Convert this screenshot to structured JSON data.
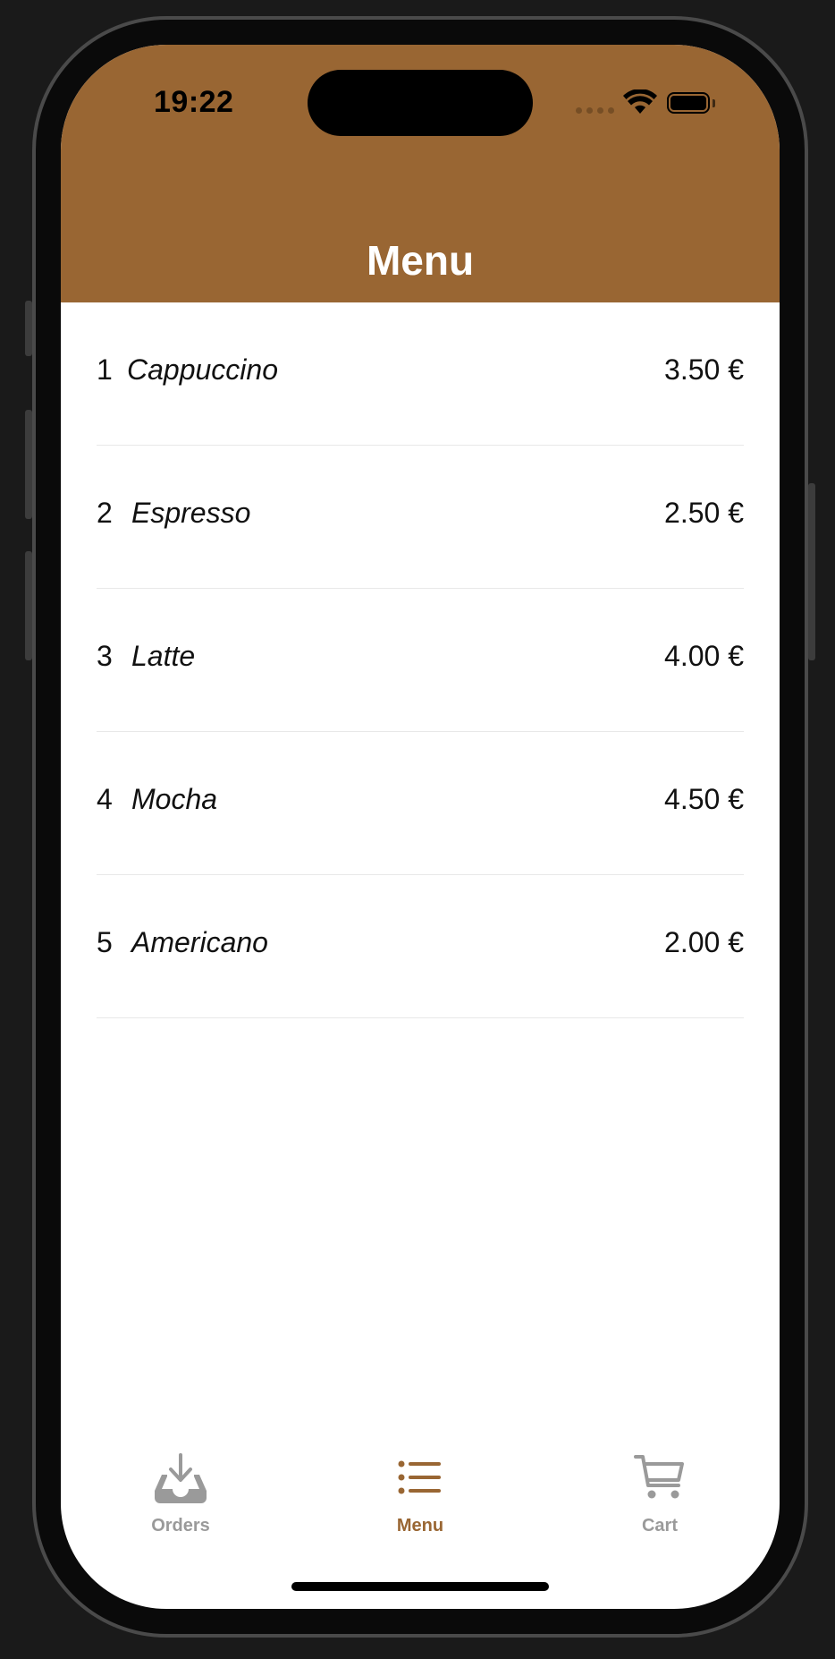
{
  "status_bar": {
    "time": "19:22"
  },
  "nav": {
    "title": "Menu"
  },
  "menu_items": [
    {
      "number": "1",
      "name": "Cappuccino",
      "price": "3.50 €"
    },
    {
      "number": "2",
      "name": "Espresso",
      "price": "2.50 €"
    },
    {
      "number": "3",
      "name": "Latte",
      "price": "4.00 €"
    },
    {
      "number": "4",
      "name": "Mocha",
      "price": "4.50 €"
    },
    {
      "number": "5",
      "name": "Americano",
      "price": "2.00 €"
    }
  ],
  "tabs": [
    {
      "label": "Orders",
      "icon": "tray-download-icon",
      "active": false
    },
    {
      "label": "Menu",
      "icon": "list-icon",
      "active": true
    },
    {
      "label": "Cart",
      "icon": "cart-icon",
      "active": false
    }
  ],
  "colors": {
    "accent": "#996633",
    "inactive_tab": "#9a9a9a",
    "background": "#ffffff",
    "frame": "#1a1a1a"
  }
}
